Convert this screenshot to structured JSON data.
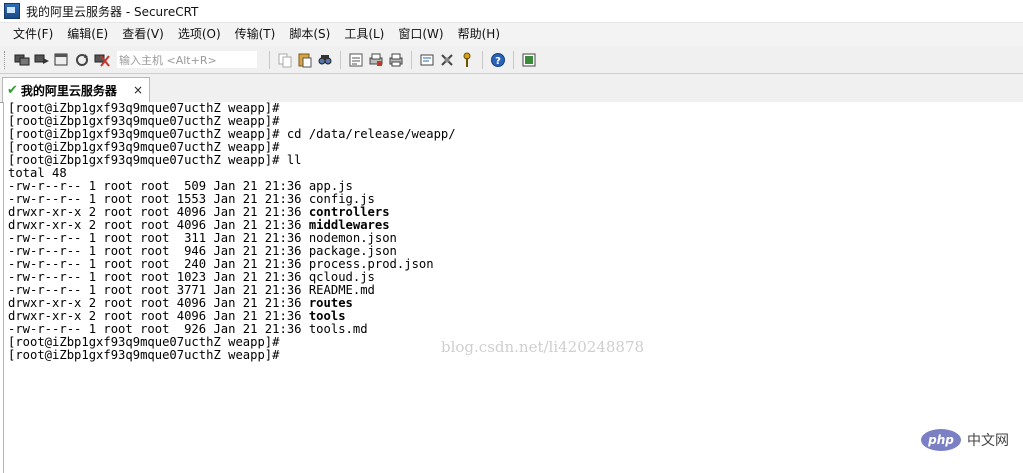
{
  "window": {
    "title": "我的阿里云服务器 - SecureCRT"
  },
  "menubar": [
    "文件(F)",
    "编辑(E)",
    "查看(V)",
    "选项(O)",
    "传输(T)",
    "脚本(S)",
    "工具(L)",
    "窗口(W)",
    "帮助(H)"
  ],
  "toolbar": {
    "command_placeholder": "输入主机 <Alt+R>",
    "icons_left": [
      "connect-icon",
      "quick-connect-icon",
      "connect-in-tab-icon",
      "reconnect-icon",
      "disconnect-icon"
    ],
    "icons_right": [
      "copy-icon",
      "paste-icon",
      "find-icon",
      "print-setup-icon",
      "print-selection-icon",
      "print-icon",
      "session-options-icon",
      "global-options-icon",
      "key-icon",
      "help-icon",
      "sftp-icon"
    ]
  },
  "tab": {
    "label": "我的阿里云服务器",
    "close": "×"
  },
  "terminal": {
    "lines": [
      {
        "text": "[root@iZbp1gxf93q9mque07ucthZ weapp]#",
        "bold": false
      },
      {
        "text": "[root@iZbp1gxf93q9mque07ucthZ weapp]#",
        "bold": false
      },
      {
        "text": "[root@iZbp1gxf93q9mque07ucthZ weapp]# cd /data/release/weapp/",
        "bold": false
      },
      {
        "text": "[root@iZbp1gxf93q9mque07ucthZ weapp]#",
        "bold": false
      },
      {
        "text": "[root@iZbp1gxf93q9mque07ucthZ weapp]# ll",
        "bold": false
      },
      {
        "text": "total 48",
        "bold": false
      },
      {
        "prefix": "-rw-r--r-- 1 root root  509 Jan 21 21:36 ",
        "name": "app.js",
        "bold": false
      },
      {
        "prefix": "-rw-r--r-- 1 root root 1553 Jan 21 21:36 ",
        "name": "config.js",
        "bold": false
      },
      {
        "prefix": "drwxr-xr-x 2 root root 4096 Jan 21 21:36 ",
        "name": "controllers",
        "bold": true
      },
      {
        "prefix": "drwxr-xr-x 2 root root 4096 Jan 21 21:36 ",
        "name": "middlewares",
        "bold": true
      },
      {
        "prefix": "-rw-r--r-- 1 root root  311 Jan 21 21:36 ",
        "name": "nodemon.json",
        "bold": false
      },
      {
        "prefix": "-rw-r--r-- 1 root root  946 Jan 21 21:36 ",
        "name": "package.json",
        "bold": false
      },
      {
        "prefix": "-rw-r--r-- 1 root root  240 Jan 21 21:36 ",
        "name": "process.prod.json",
        "bold": false
      },
      {
        "prefix": "-rw-r--r-- 1 root root 1023 Jan 21 21:36 ",
        "name": "qcloud.js",
        "bold": false
      },
      {
        "prefix": "-rw-r--r-- 1 root root 3771 Jan 21 21:36 ",
        "name": "README.md",
        "bold": false
      },
      {
        "prefix": "drwxr-xr-x 2 root root 4096 Jan 21 21:36 ",
        "name": "routes",
        "bold": true
      },
      {
        "prefix": "drwxr-xr-x 2 root root 4096 Jan 21 21:36 ",
        "name": "tools",
        "bold": true
      },
      {
        "prefix": "-rw-r--r-- 1 root root  926 Jan 21 21:36 ",
        "name": "tools.md",
        "bold": false
      },
      {
        "text": "[root@iZbp1gxf93q9mque07ucthZ weapp]#",
        "bold": false
      },
      {
        "text": "[root@iZbp1gxf93q9mque07ucthZ weapp]#",
        "bold": false
      }
    ],
    "watermark": "blog.csdn.net/li420248878"
  },
  "corner_logo": {
    "badge": "php",
    "text": "中文网"
  },
  "colors": {
    "menubar_bg": "#f3f3f3",
    "toolbar_bg": "#f0f0f0",
    "terminal_bg": "#ffffff",
    "tab_check": "#2aa02a",
    "php_badge": "#7b7fc4"
  }
}
